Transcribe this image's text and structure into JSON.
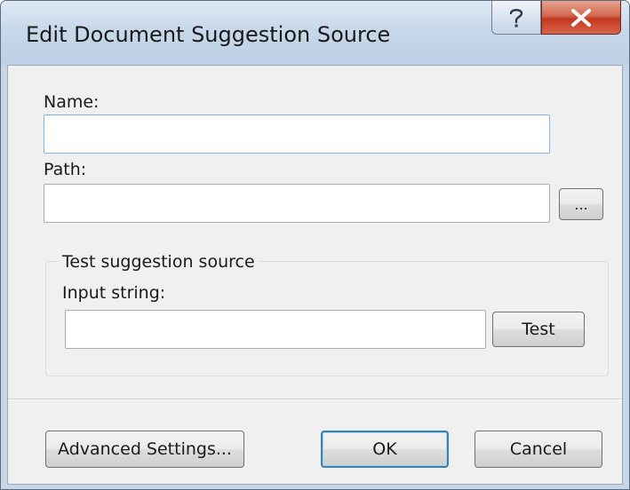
{
  "window": {
    "title": "Edit Document Suggestion Source",
    "help_icon": "question-mark-icon",
    "close_icon": "close-x-icon"
  },
  "form": {
    "name_label": "Name:",
    "name_value": "",
    "path_label": "Path:",
    "path_value": "",
    "browse_label": "..."
  },
  "test_group": {
    "title": "Test suggestion source",
    "input_label": "Input string:",
    "input_value": "",
    "test_button": "Test"
  },
  "footer": {
    "advanced_button": "Advanced Settings...",
    "ok_button": "OK",
    "cancel_button": "Cancel"
  },
  "colors": {
    "titlebar": "#c8d8ea",
    "close_button": "#c2381f",
    "client_background": "#f0f0f0",
    "focus_border": "#7eb4ea"
  }
}
